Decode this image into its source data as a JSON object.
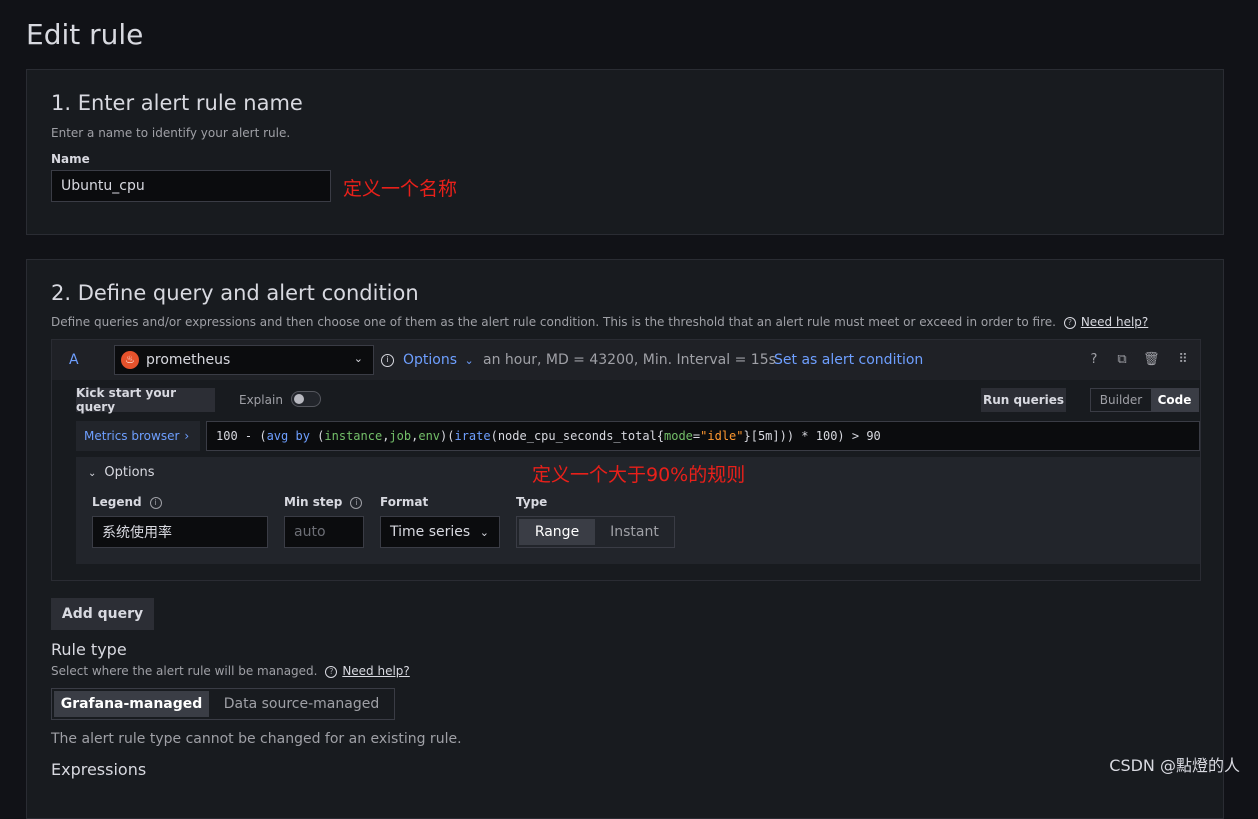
{
  "page_title": "Edit rule",
  "section1": {
    "title": "1. Enter alert rule name",
    "description": "Enter a name to identify your alert rule.",
    "name_label": "Name",
    "name_value": "Ubuntu_cpu",
    "annotation": "定义一个名称"
  },
  "section2": {
    "title": "2. Define query and alert condition",
    "description": "Define queries and/or expressions and then choose one of them as the alert rule condition. This is the threshold that an alert rule must meet or exceed in order to fire.",
    "help": "Need help?",
    "query": {
      "ref_id": "A",
      "datasource": "prometheus",
      "options_label": "Options",
      "options_summary": "an hour, MD = 43200, Min. Interval = 15s",
      "set_condition": "Set as alert condition",
      "kick_start": "Kick start your query",
      "explain": "Explain",
      "run_queries": "Run queries",
      "mode_builder": "Builder",
      "mode_code": "Code",
      "metrics_browser": "Metrics browser",
      "expr_parts": [
        "100 - (",
        "avg by",
        " (",
        "instance",
        ",",
        "job",
        ",",
        "env",
        ")(",
        "irate",
        "(node_cpu_seconds_total{",
        "mode",
        "=",
        "\"idle\"",
        "}[5m])) * 100) > 90"
      ],
      "annotation": "定义一个大于90%的规则",
      "options_panel": {
        "title": "Options",
        "legend_label": "Legend",
        "legend_value": "系统使用率",
        "minstep_label": "Min step",
        "minstep_placeholder": "auto",
        "format_label": "Format",
        "format_value": "Time series",
        "type_label": "Type",
        "type_range": "Range",
        "type_instant": "Instant"
      }
    },
    "add_query": "Add query",
    "rule_type_title": "Rule type",
    "rule_type_desc": "Select where the alert rule will be managed.",
    "rule_type_help": "Need help?",
    "grafana_managed": "Grafana-managed",
    "datasource_managed": "Data source-managed",
    "rule_type_note": "The alert rule type cannot be changed for an existing rule.",
    "expressions_title": "Expressions"
  },
  "watermark": "CSDN @點燈的人"
}
